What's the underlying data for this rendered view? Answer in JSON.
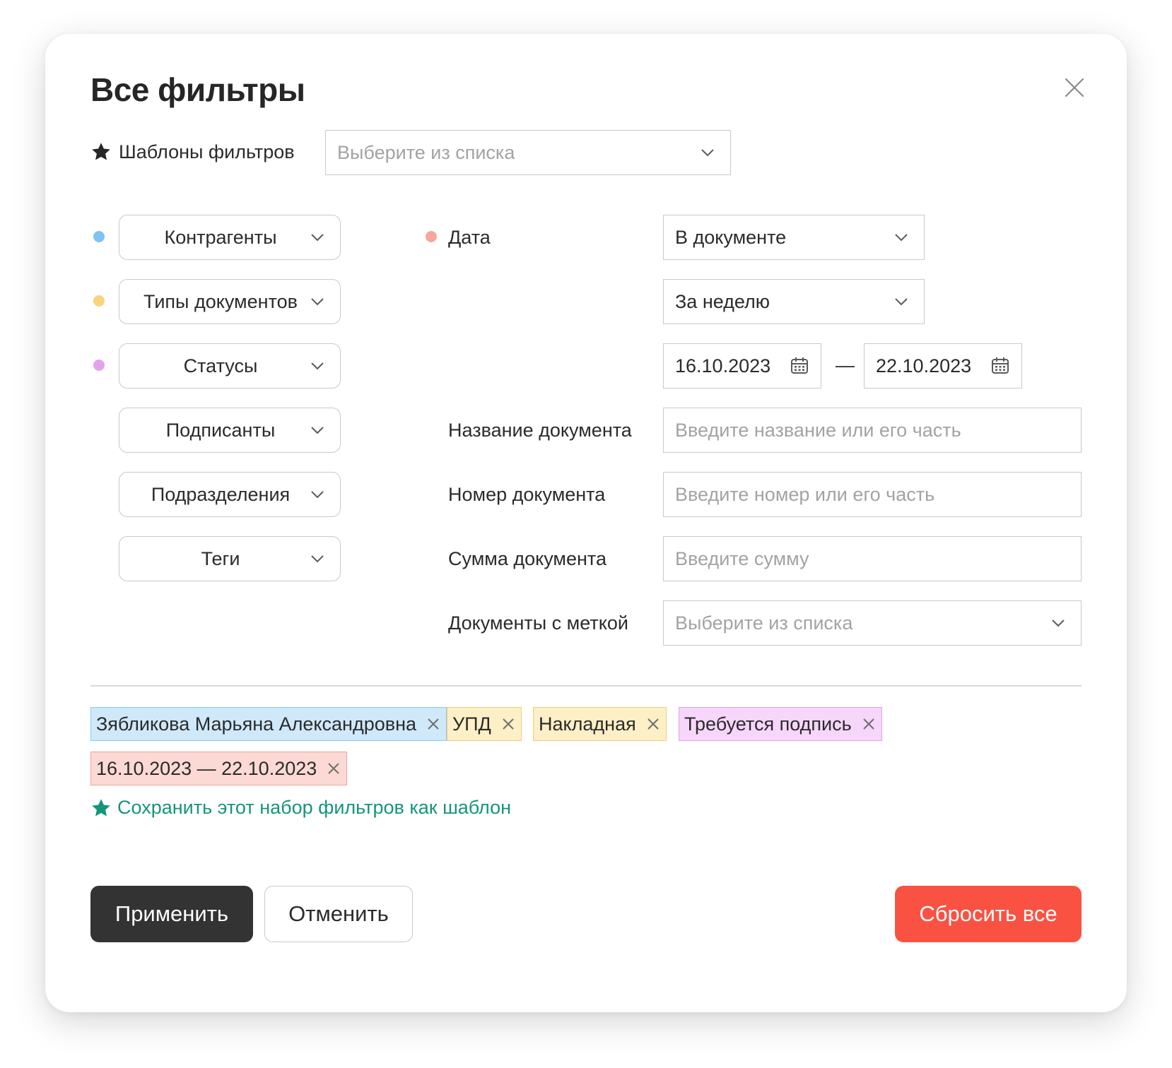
{
  "modal": {
    "title": "Все фильтры"
  },
  "templates": {
    "label": "Шаблоны фильтров",
    "placeholder": "Выберите из списка"
  },
  "left_filters": [
    {
      "label": "Контрагенты",
      "dot_color": "#7ec4f2"
    },
    {
      "label": "Типы документов",
      "dot_color": "#f9d47e"
    },
    {
      "label": "Статусы",
      "dot_color": "#e3a3ec"
    },
    {
      "label": "Подписанты",
      "dot_color": null
    },
    {
      "label": "Подразделения",
      "dot_color": null
    },
    {
      "label": "Теги",
      "dot_color": null
    }
  ],
  "date": {
    "label": "Дата",
    "dot_color": "#f7a79b",
    "type_value": "В документе",
    "period_value": "За неделю",
    "from": "16.10.2023",
    "separator": "—",
    "to": "22.10.2023"
  },
  "fields": {
    "doc_name": {
      "label": "Название документа",
      "placeholder": "Введите название или его часть"
    },
    "doc_number": {
      "label": "Номер документа",
      "placeholder": "Введите номер или его часть"
    },
    "doc_sum": {
      "label": "Сумма документа",
      "placeholder": "Введите сумму"
    },
    "doc_mark": {
      "label": "Документы с меткой",
      "placeholder": "Выберите из списка"
    }
  },
  "chips": [
    {
      "text": "Зябликова Марьяна Александровна",
      "bg": "#cfe9fb",
      "border": "#8cc8f0"
    },
    {
      "text": "УПД",
      "bg": "#fdefc6",
      "border": "#f3cc79"
    },
    {
      "text": "Накладная",
      "bg": "#fdefc6",
      "border": "#f3cc79"
    },
    {
      "text": "Требуется подпись",
      "bg": "#f6d6fb",
      "border": "#dca2e6"
    },
    {
      "text": "16.10.2023 — 22.10.2023",
      "bg": "#fcd9d4",
      "border": "#f3a196"
    }
  ],
  "save_template_link": "Сохранить этот набор фильтров как шаблон",
  "actions": {
    "apply": "Применить",
    "cancel": "Отменить",
    "reset": "Сбросить все"
  },
  "colors": {
    "accent_green": "#16957a",
    "reset_red": "#f95243",
    "apply_dark": "#333333"
  }
}
